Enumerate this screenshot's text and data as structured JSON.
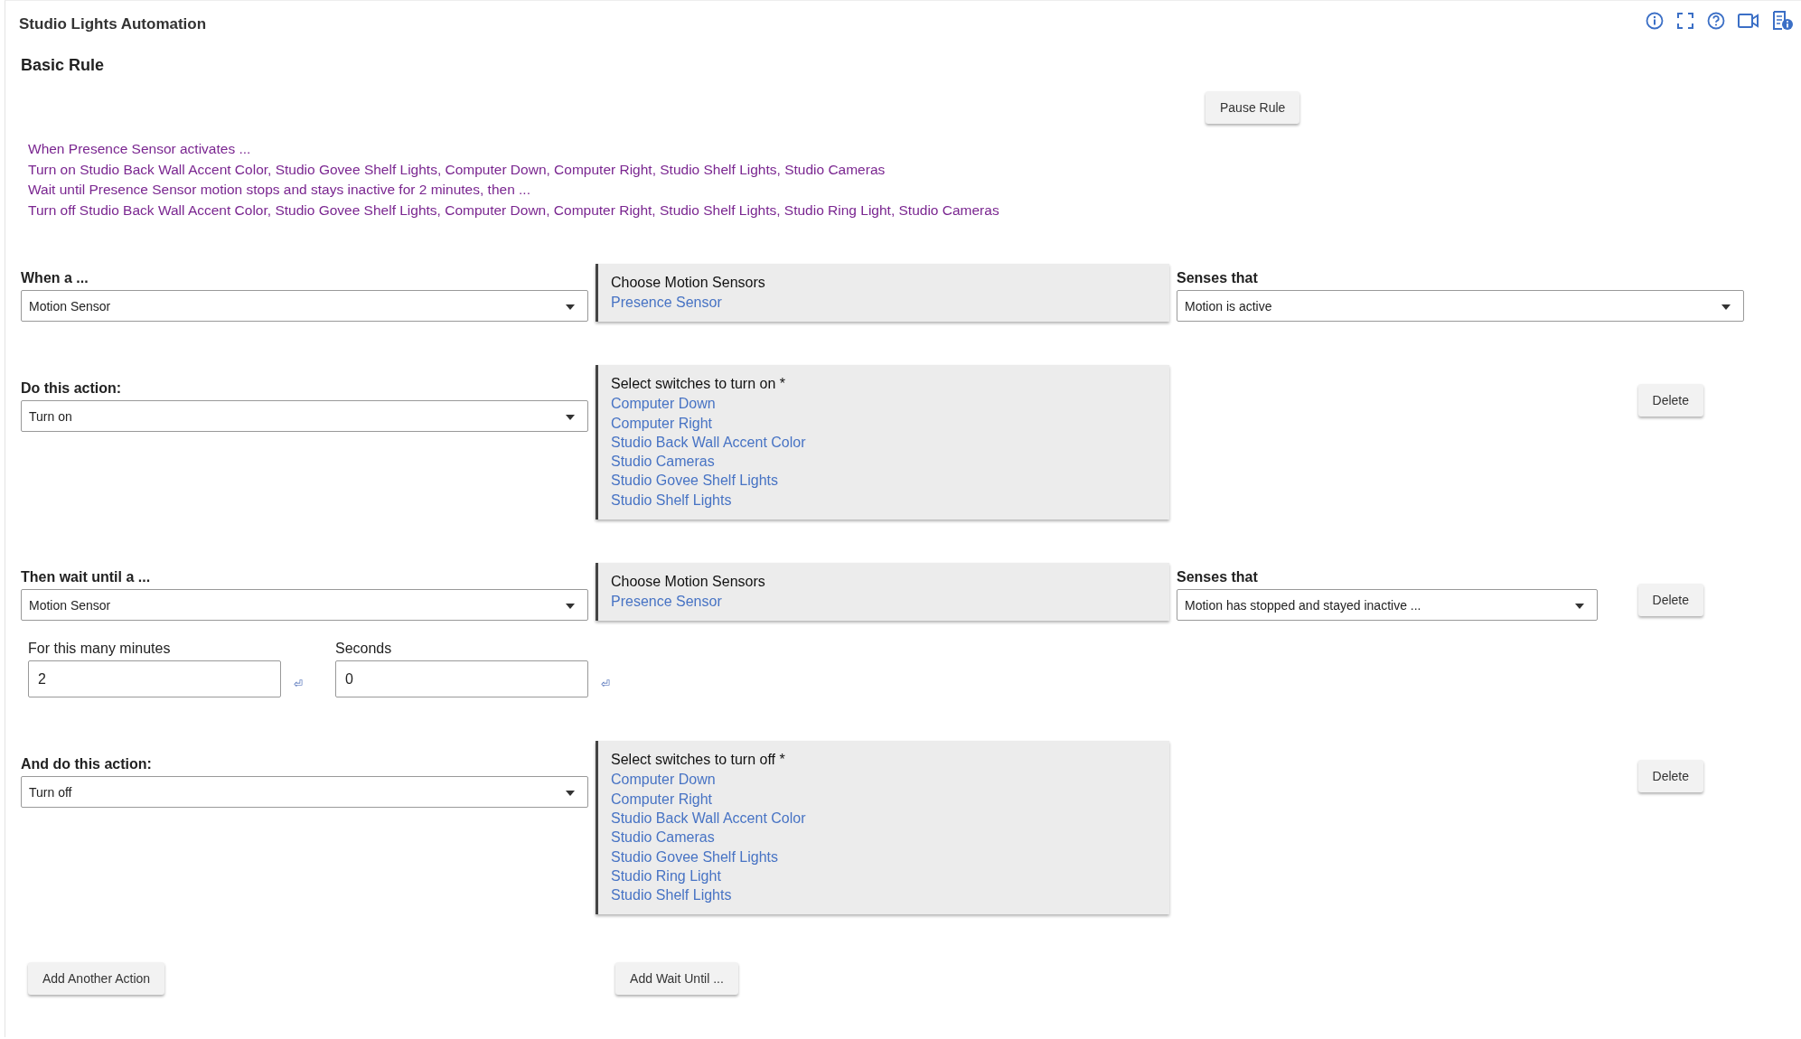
{
  "app_title": "Studio Lights Automation",
  "rule_type": "Basic Rule",
  "pause_button": "Pause Rule",
  "summary": [
    "When Presence Sensor activates ...",
    "Turn on Studio Back Wall Accent Color, Studio Govee Shelf Lights, Computer Down, Computer Right, Studio Shelf Lights, Studio Cameras",
    "Wait until Presence Sensor motion stops and stays inactive for 2 minutes, then ...",
    "Turn off Studio Back Wall Accent Color, Studio Govee Shelf Lights, Computer Down, Computer Right, Studio Shelf Lights, Studio Ring Light, Studio Cameras"
  ],
  "sections": [
    {
      "kind": "trigger",
      "label": "When a ...",
      "select": "Motion Sensor",
      "picker": {
        "title": "Choose Motion Sensors",
        "items": [
          "Presence Sensor"
        ]
      },
      "senses": {
        "label": "Senses that",
        "value": "Motion is active"
      }
    },
    {
      "kind": "action",
      "label": "Do this action:",
      "select": "Turn on",
      "picker": {
        "title": "Select switches to turn on *",
        "items": [
          "Computer Down",
          "Computer Right",
          "Studio Back Wall Accent Color",
          "Studio Cameras",
          "Studio Govee Shelf Lights",
          "Studio Shelf Lights"
        ]
      },
      "delete": "Delete"
    },
    {
      "kind": "wait",
      "label": "Then wait until a ...",
      "select": "Motion Sensor",
      "picker": {
        "title": "Choose Motion Sensors",
        "items": [
          "Presence Sensor"
        ]
      },
      "senses": {
        "label": "Senses that",
        "value": "Motion has stopped and stayed inactive ..."
      },
      "delete": "Delete",
      "durations": [
        {
          "label": "For this many minutes",
          "value": "2",
          "enter_symbol": "⏎"
        },
        {
          "label": "Seconds",
          "value": "0",
          "enter_symbol": "⏎"
        }
      ]
    },
    {
      "kind": "action",
      "label": "And do this action:",
      "select": "Turn off",
      "picker": {
        "title": "Select switches to turn off *",
        "items": [
          "Computer Down",
          "Computer Right",
          "Studio Back Wall Accent Color",
          "Studio Cameras",
          "Studio Govee Shelf Lights",
          "Studio Ring Light",
          "Studio Shelf Lights"
        ]
      },
      "delete": "Delete"
    }
  ],
  "footer_buttons": [
    "Add Another Action",
    "Add Wait Until ..."
  ]
}
